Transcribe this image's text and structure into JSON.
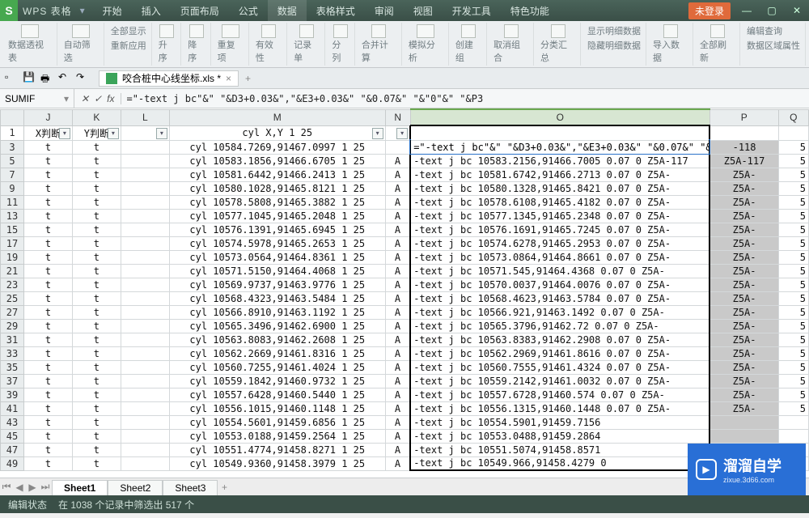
{
  "app": {
    "name": "WPS 表格",
    "login_badge": "未登录"
  },
  "menu": {
    "tabs": [
      "开始",
      "插入",
      "页面布局",
      "公式",
      "数据",
      "表格样式",
      "审阅",
      "视图",
      "开发工具",
      "特色功能"
    ],
    "active": 4
  },
  "ribbon": {
    "pivot": "数据透视表",
    "autofilter": "自动筛选",
    "showall": "全部显示",
    "reapply": "重新应用",
    "asc": "升序",
    "desc": "降序",
    "dup": "重复项",
    "valid": "有效性",
    "record": "记录单",
    "split": "分列",
    "consol": "合并计算",
    "whatif": "模拟分析",
    "group_create": "创建组",
    "ungroup": "取消组合",
    "subtotal": "分类汇总",
    "show_detail": "显示明细数据",
    "hide_detail": "隐藏明细数据",
    "import": "导入数据",
    "refresh": "全部刷新",
    "range_prop": "数据区域属性",
    "editq": "编辑查询"
  },
  "doc_tab": {
    "name": "咬合桩中心线坐标.xls *"
  },
  "formula_bar": {
    "name_box": "SUMIF",
    "formula": "=\"-text j bc\"&\" \"&D3+0.03&\",\"&E3+0.03&\" \"&0.07&\" \"&\"0\"&\" \"&P3"
  },
  "columns": [
    "J",
    "K",
    "L",
    "M",
    "N",
    "O",
    "P",
    "Q"
  ],
  "header_row": {
    "J": "X判断",
    "K": "Y判断",
    "L": "",
    "M": "cyl X,Y 1 25",
    "N": "",
    "O": "",
    "P": "",
    "Q": ""
  },
  "rows": [
    {
      "n": 3,
      "J": "t",
      "K": "t",
      "M": "cyl 10584.7269,91467.0997 1 25",
      "N": "",
      "O": "=\"-text j bc\"&\" \"&D3+0.03&\",\"&E3+0.03&\" \"&0.07&\" \"&\"0\"&\" \"&P3",
      "P": "-118",
      "Q": "5"
    },
    {
      "n": 5,
      "J": "t",
      "K": "t",
      "M": "cyl 10583.1856,91466.6705 1 25",
      "N": "A",
      "O": "-text j bc 10583.2156,91466.7005 0.07 0 Z5A-117",
      "P": "Z5A-117",
      "Q": "5"
    },
    {
      "n": 7,
      "J": "t",
      "K": "t",
      "M": "cyl 10581.6442,91466.2413 1 25",
      "N": "A",
      "O": "-text j bc 10581.6742,91466.2713 0.07 0 Z5A-",
      "P": "Z5A-",
      "Q": "5"
    },
    {
      "n": 9,
      "J": "t",
      "K": "t",
      "M": "cyl 10580.1028,91465.8121 1 25",
      "N": "A",
      "O": "-text j bc 10580.1328,91465.8421 0.07 0 Z5A-",
      "P": "Z5A-",
      "Q": "5"
    },
    {
      "n": 11,
      "J": "t",
      "K": "t",
      "M": "cyl 10578.5808,91465.3882 1 25",
      "N": "A",
      "O": "-text j bc 10578.6108,91465.4182 0.07 0 Z5A-",
      "P": "Z5A-",
      "Q": "5"
    },
    {
      "n": 13,
      "J": "t",
      "K": "t",
      "M": "cyl 10577.1045,91465.2048 1 25",
      "N": "A",
      "O": "-text j bc 10577.1345,91465.2348 0.07 0 Z5A-",
      "P": "Z5A-",
      "Q": "5"
    },
    {
      "n": 15,
      "J": "t",
      "K": "t",
      "M": "cyl 10576.1391,91465.6945 1 25",
      "N": "A",
      "O": "-text j bc 10576.1691,91465.7245 0.07 0 Z5A-",
      "P": "Z5A-",
      "Q": "5"
    },
    {
      "n": 17,
      "J": "t",
      "K": "t",
      "M": "cyl 10574.5978,91465.2653 1 25",
      "N": "A",
      "O": "-text j bc 10574.6278,91465.2953 0.07 0 Z5A-",
      "P": "Z5A-",
      "Q": "5"
    },
    {
      "n": 19,
      "J": "t",
      "K": "t",
      "M": "cyl 10573.0564,91464.8361 1 25",
      "N": "A",
      "O": "-text j bc 10573.0864,91464.8661 0.07 0 Z5A-",
      "P": "Z5A-",
      "Q": "5"
    },
    {
      "n": 21,
      "J": "t",
      "K": "t",
      "M": "cyl 10571.5150,91464.4068 1 25",
      "N": "A",
      "O": "-text j bc 10571.545,91464.4368 0.07 0 Z5A-",
      "P": "Z5A-",
      "Q": "5"
    },
    {
      "n": 23,
      "J": "t",
      "K": "t",
      "M": "cyl 10569.9737,91463.9776 1 25",
      "N": "A",
      "O": "-text j bc 10570.0037,91464.0076 0.07 0 Z5A-",
      "P": "Z5A-",
      "Q": "5"
    },
    {
      "n": 25,
      "J": "t",
      "K": "t",
      "M": "cyl 10568.4323,91463.5484 1 25",
      "N": "A",
      "O": "-text j bc 10568.4623,91463.5784 0.07 0 Z5A-",
      "P": "Z5A-",
      "Q": "5"
    },
    {
      "n": 27,
      "J": "t",
      "K": "t",
      "M": "cyl 10566.8910,91463.1192 1 25",
      "N": "A",
      "O": "-text j bc 10566.921,91463.1492 0.07 0 Z5A-",
      "P": "Z5A-",
      "Q": "5"
    },
    {
      "n": 29,
      "J": "t",
      "K": "t",
      "M": "cyl 10565.3496,91462.6900 1 25",
      "N": "A",
      "O": "-text j bc 10565.3796,91462.72 0.07 0 Z5A-",
      "P": "Z5A-",
      "Q": "5"
    },
    {
      "n": 31,
      "J": "t",
      "K": "t",
      "M": "cyl 10563.8083,91462.2608 1 25",
      "N": "A",
      "O": "-text j bc 10563.8383,91462.2908 0.07 0 Z5A-",
      "P": "Z5A-",
      "Q": "5"
    },
    {
      "n": 33,
      "J": "t",
      "K": "t",
      "M": "cyl 10562.2669,91461.8316 1 25",
      "N": "A",
      "O": "-text j bc 10562.2969,91461.8616 0.07 0 Z5A-",
      "P": "Z5A-",
      "Q": "5"
    },
    {
      "n": 35,
      "J": "t",
      "K": "t",
      "M": "cyl 10560.7255,91461.4024 1 25",
      "N": "A",
      "O": "-text j bc 10560.7555,91461.4324 0.07 0 Z5A-",
      "P": "Z5A-",
      "Q": "5"
    },
    {
      "n": 37,
      "J": "t",
      "K": "t",
      "M": "cyl 10559.1842,91460.9732 1 25",
      "N": "A",
      "O": "-text j bc 10559.2142,91461.0032 0.07 0 Z5A-",
      "P": "Z5A-",
      "Q": "5"
    },
    {
      "n": 39,
      "J": "t",
      "K": "t",
      "M": "cyl 10557.6428,91460.5440 1 25",
      "N": "A",
      "O": "-text j bc 10557.6728,91460.574 0.07 0 Z5A-",
      "P": "Z5A-",
      "Q": "5"
    },
    {
      "n": 41,
      "J": "t",
      "K": "t",
      "M": "cyl 10556.1015,91460.1148 1 25",
      "N": "A",
      "O": "-text j bc 10556.1315,91460.1448 0.07 0 Z5A-",
      "P": "Z5A-",
      "Q": "5"
    },
    {
      "n": 43,
      "J": "t",
      "K": "t",
      "M": "cyl 10554.5601,91459.6856 1 25",
      "N": "A",
      "O": "-text j bc 10554.5901,91459.7156",
      "P": "",
      "Q": ""
    },
    {
      "n": 45,
      "J": "t",
      "K": "t",
      "M": "cyl 10553.0188,91459.2564 1 25",
      "N": "A",
      "O": "-text j bc 10553.0488,91459.2864",
      "P": "",
      "Q": ""
    },
    {
      "n": 47,
      "J": "t",
      "K": "t",
      "M": "cyl 10551.4774,91458.8271 1 25",
      "N": "A",
      "O": "-text j bc 10551.5074,91458.8571",
      "P": "",
      "Q": ""
    },
    {
      "n": 49,
      "J": "t",
      "K": "t",
      "M": "cyl 10549.9360,91458.3979 1 25",
      "N": "A",
      "O": "-text j bc 10549.966,91458.4279 0",
      "P": "",
      "Q": ""
    }
  ],
  "sheets": {
    "tabs": [
      "Sheet1",
      "Sheet2",
      "Sheet3"
    ],
    "active": 0,
    "add": "+"
  },
  "status": {
    "mode": "编辑状态",
    "filter": "在 1038 个记录中筛选出 517 个"
  },
  "watermark": {
    "title": "溜溜自学",
    "sub": "zixue.3d66.com"
  }
}
